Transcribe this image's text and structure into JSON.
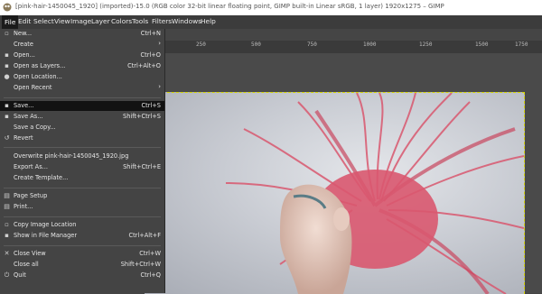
{
  "window": {
    "title": "[pink-hair-1450045_1920] (imported)-15.0 (RGB color 32-bit linear floating point, GIMP built-in Linear sRGB, 1 layer) 1920x1275 – GIMP"
  },
  "menubar": [
    "File",
    "Edit",
    "Select",
    "View",
    "Image",
    "Layer",
    "Colors",
    "Tools",
    "Filters",
    "Windows",
    "Help"
  ],
  "ruler": {
    "top": [
      "250",
      "500",
      "750",
      "1000",
      "1250",
      "1500",
      "1750"
    ]
  },
  "file_menu": {
    "new": {
      "label": "New...",
      "shortcut": "Ctrl+N"
    },
    "create": {
      "label": "Create"
    },
    "open": {
      "label": "Open...",
      "shortcut": "Ctrl+O"
    },
    "open_layers": {
      "label": "Open as Layers...",
      "shortcut": "Ctrl+Alt+O"
    },
    "open_location": {
      "label": "Open Location..."
    },
    "open_recent": {
      "label": "Open Recent"
    },
    "save": {
      "label": "Save...",
      "shortcut": "Ctrl+S"
    },
    "save_as": {
      "label": "Save As...",
      "shortcut": "Shift+Ctrl+S"
    },
    "save_copy": {
      "label": "Save a Copy..."
    },
    "revert": {
      "label": "Revert"
    },
    "overwrite": {
      "label": "Overwrite pink-hair-1450045_1920.jpg"
    },
    "export_as": {
      "label": "Export As...",
      "shortcut": "Shift+Ctrl+E"
    },
    "create_template": {
      "label": "Create Template..."
    },
    "page_setup": {
      "label": "Page Setup"
    },
    "print": {
      "label": "Print..."
    },
    "copy_location": {
      "label": "Copy Image Location"
    },
    "show_fm": {
      "label": "Show in File Manager",
      "shortcut": "Ctrl+Alt+F"
    },
    "close_view": {
      "label": "Close View",
      "shortcut": "Ctrl+W"
    },
    "close_all": {
      "label": "Close all",
      "shortcut": "Shift+Ctrl+W"
    },
    "quit": {
      "label": "Quit",
      "shortcut": "Ctrl+Q"
    }
  },
  "colors": {
    "hair": "#d9586f",
    "selection_border": "#d6d600",
    "menu_bg": "#444444"
  }
}
